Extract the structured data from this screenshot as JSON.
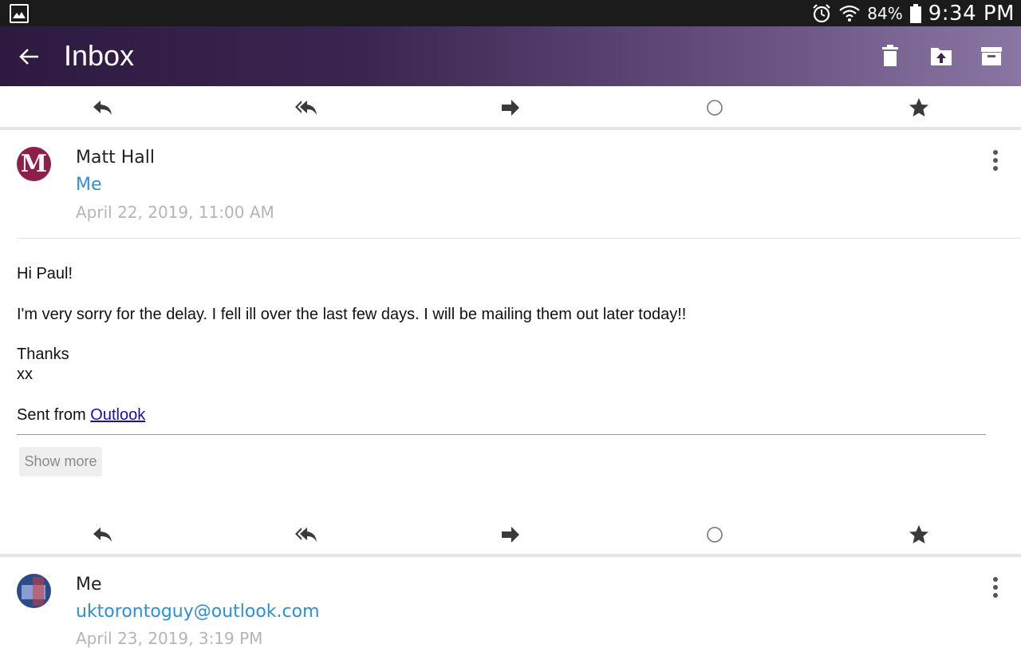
{
  "status_bar": {
    "battery_percent": "84%",
    "time": "9:34 PM",
    "icons": [
      "gallery-icon",
      "alarm-icon",
      "wifi-icon",
      "battery-icon"
    ]
  },
  "app_bar": {
    "title": "Inbox",
    "actions": [
      "delete-icon",
      "move-to-folder-icon",
      "archive-icon"
    ]
  },
  "message_actions": [
    "reply-icon",
    "reply-all-icon",
    "forward-icon",
    "mark-unread-icon",
    "star-icon"
  ],
  "messages": [
    {
      "sender": "Matt Hall",
      "recipient": "Me",
      "date": "April 22, 2019, 11:00 AM",
      "avatar_letter": "M",
      "avatar_color": "#8e1f4a",
      "body": {
        "greeting": "Hi Paul!",
        "paragraph": "I'm very sorry for the delay. I fell ill over the last few days. I will be mailing them out later today!!",
        "signoff_1": "Thanks",
        "signoff_2": "xx",
        "sent_from_prefix": "Sent from ",
        "sent_from_link": "Outlook"
      },
      "show_more_label": "Show more"
    },
    {
      "sender": "Me",
      "recipient": "uktorontoguy@outlook.com",
      "date": "April 23, 2019, 3:19 PM",
      "avatar_color": "#2b4a8a"
    }
  ],
  "colors": {
    "accent_link": "#2d8fd5",
    "appbar_start": "#2e1a3f",
    "appbar_end": "#8a76a3"
  }
}
